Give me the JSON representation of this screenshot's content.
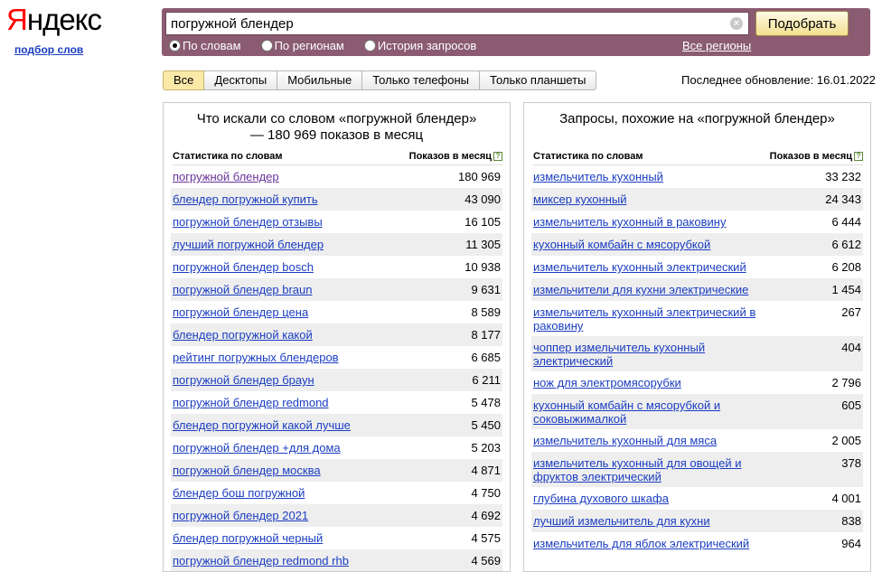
{
  "logo": {
    "first": "Я",
    "rest": "ндекс"
  },
  "subtitle": "подбор слов",
  "search": {
    "value": "погружной блендер",
    "button": "Подобрать",
    "radios": [
      {
        "label": "По словам",
        "checked": true
      },
      {
        "label": "По регионам",
        "checked": false
      },
      {
        "label": "История запросов",
        "checked": false
      }
    ],
    "regions_link": "Все регионы"
  },
  "tabs": [
    "Все",
    "Десктопы",
    "Мобильные",
    "Только телефоны",
    "Только планшеты"
  ],
  "active_tab": "Все",
  "last_update": "Последнее обновление: 16.01.2022",
  "left": {
    "title": "Что искали со словом «погружной блендер» — 180 969 показов в месяц",
    "col_words": "Статистика по словам",
    "col_count": "Показов в месяц",
    "help_icon": "?",
    "rows": [
      {
        "q": "погружной блендер",
        "n": "180 969"
      },
      {
        "q": "блендер погружной купить",
        "n": "43 090"
      },
      {
        "q": "погружной блендер отзывы",
        "n": "16 105"
      },
      {
        "q": "лучший погружной блендер",
        "n": "11 305"
      },
      {
        "q": "погружной блендер bosch",
        "n": "10 938"
      },
      {
        "q": "погружной блендер braun",
        "n": "9 631"
      },
      {
        "q": "погружной блендер цена",
        "n": "8 589"
      },
      {
        "q": "блендер погружной какой",
        "n": "8 177"
      },
      {
        "q": "рейтинг погружных блендеров",
        "n": "6 685"
      },
      {
        "q": "погружной блендер браун",
        "n": "6 211"
      },
      {
        "q": "погружной блендер redmond",
        "n": "5 478"
      },
      {
        "q": "блендер погружной какой лучше",
        "n": "5 450"
      },
      {
        "q": "погружной блендер +для дома",
        "n": "5 203"
      },
      {
        "q": "погружной блендер москва",
        "n": "4 871"
      },
      {
        "q": "блендер бош погружной",
        "n": "4 750"
      },
      {
        "q": "погружной блендер 2021",
        "n": "4 692"
      },
      {
        "q": "блендер погружной черный",
        "n": "4 575"
      },
      {
        "q": "погружной блендер redmond rhb",
        "n": "4 569"
      }
    ]
  },
  "right": {
    "title": "Запросы, похожие на «погружной блендер»",
    "col_words": "Статистика по словам",
    "col_count": "Показов в месяц",
    "help_icon": "?",
    "rows": [
      {
        "q": "измельчитель кухонный",
        "n": "33 232"
      },
      {
        "q": "миксер кухонный",
        "n": "24 343"
      },
      {
        "q": "измельчитель кухонный в раковину",
        "n": "6 444"
      },
      {
        "q": "кухонный комбайн с мясорубкой",
        "n": "6 612"
      },
      {
        "q": "измельчитель кухонный электрический",
        "n": "6 208"
      },
      {
        "q": "измельчители для кухни электрические",
        "n": "1 454"
      },
      {
        "q": "измельчитель кухонный электрический в раковину",
        "n": "267"
      },
      {
        "q": "чоппер измельчитель кухонный электрический",
        "n": "404"
      },
      {
        "q": "нож для электромясорубки",
        "n": "2 796"
      },
      {
        "q": "кухонный комбайн с мясорубкой и соковыжималкой",
        "n": "605"
      },
      {
        "q": "измельчитель кухонный для мяса",
        "n": "2 005"
      },
      {
        "q": "измельчитель кухонный для овощей и фруктов электрический",
        "n": "378"
      },
      {
        "q": "глубина духового шкафа",
        "n": "4 001"
      },
      {
        "q": "лучший измельчитель для кухни",
        "n": "838"
      },
      {
        "q": "измельчитель для яблок электрический",
        "n": "964"
      }
    ]
  }
}
